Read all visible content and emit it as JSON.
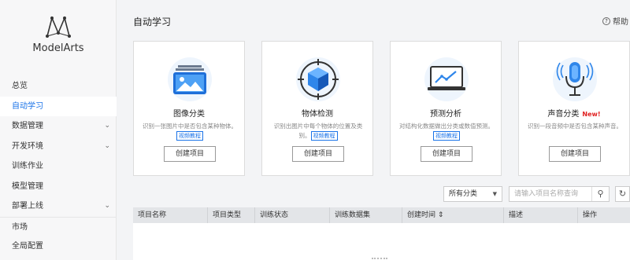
{
  "brand": {
    "name": "ModelArts"
  },
  "sidebar": {
    "items": [
      {
        "label": "总览",
        "chevron": false,
        "active": false
      },
      {
        "label": "自动学习",
        "chevron": false,
        "active": true
      },
      {
        "label": "数据管理",
        "chevron": true,
        "active": false
      },
      {
        "label": "开发环境",
        "chevron": true,
        "active": false
      },
      {
        "label": "训练作业",
        "chevron": false,
        "active": false
      },
      {
        "label": "模型管理",
        "chevron": false,
        "active": false
      },
      {
        "label": "部署上线",
        "chevron": true,
        "active": false
      },
      {
        "label": "市场",
        "chevron": false,
        "active": false
      },
      {
        "label": "全局配置",
        "chevron": false,
        "active": false
      }
    ]
  },
  "header": {
    "title": "自动学习",
    "help_label": "帮助"
  },
  "cards": [
    {
      "title": "图像分类",
      "new": "",
      "desc": "识别一张图片中是否包含某种物体。",
      "tutorial": "视频教程",
      "button": "创建项目",
      "icon": "image-classification-icon"
    },
    {
      "title": "物体检测",
      "new": "",
      "desc": "识别出图片中每个物体的位置及类别。",
      "tutorial": "视频教程",
      "button": "创建项目",
      "icon": "object-detection-icon"
    },
    {
      "title": "预测分析",
      "new": "",
      "desc": "对结构化数据做出分类或数值预测。",
      "tutorial": "视频教程",
      "button": "创建项目",
      "icon": "prediction-analysis-icon"
    },
    {
      "title": "声音分类",
      "new": "New!",
      "desc": "识别一段音频中是否包含某种声音。",
      "tutorial": "",
      "button": "创建项目",
      "icon": "microphone-icon"
    }
  ],
  "toolbar": {
    "filter_value": "所有分类",
    "search_placeholder": "请输入项目名称查询",
    "search_icon": "search-icon",
    "refresh_icon": "refresh-icon"
  },
  "table": {
    "columns": [
      "项目名称",
      "项目类型",
      "训练状态",
      "训练数据集",
      "创建时间 ⇕",
      "描述",
      "操作"
    ],
    "rows": []
  },
  "colors": {
    "accent": "#1a73e8",
    "new_badge": "#e02020",
    "header_bg": "#e3e5e8"
  }
}
